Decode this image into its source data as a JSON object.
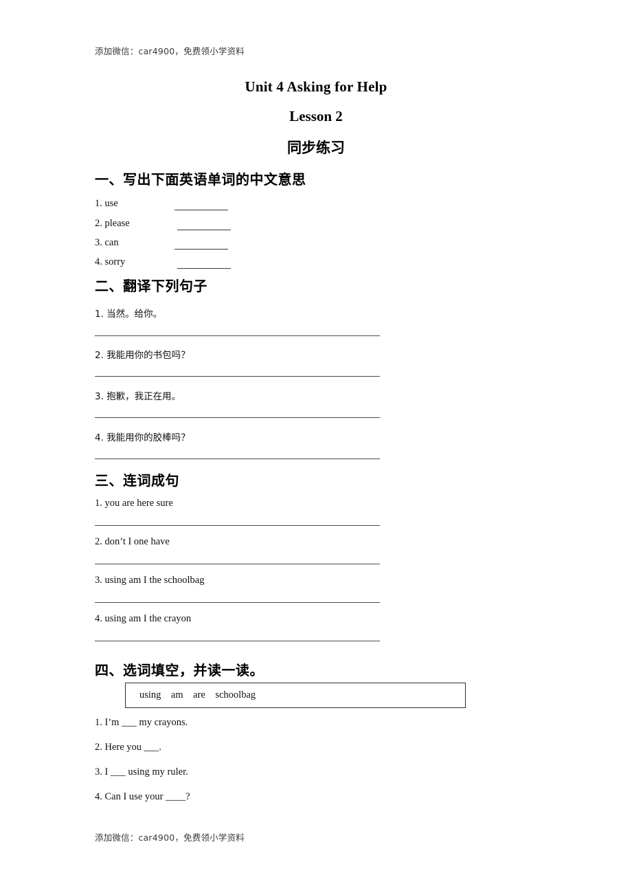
{
  "watermark": {
    "top": "添加微信：car4900，免费领小学资料",
    "bottom": "添加微信：car4900，免费领小学资料"
  },
  "titles": {
    "unit": "Unit 4 Asking for Help",
    "lesson": "Lesson 2",
    "chinese": "同步练习"
  },
  "sections": [
    {
      "heading": "一、写出下面英语单词的中文意思",
      "items": [
        {
          "label": "1. use"
        },
        {
          "label": "2. please"
        },
        {
          "label": "3. can"
        },
        {
          "label": "4. sorry"
        }
      ]
    },
    {
      "heading": "二、翻译下列句子",
      "items": [
        {
          "label": "1. 当然。给你。"
        },
        {
          "label": "2. 我能用你的书包吗？"
        },
        {
          "label": "3. 抱歉，我正在用。"
        },
        {
          "label": "4. 我能用你的胶棒吗？"
        }
      ]
    },
    {
      "heading": "三、连词成句",
      "items": [
        {
          "label": "1. you are here sure"
        },
        {
          "label": "2. don’t I one have"
        },
        {
          "label": "3. using am I the schoolbag"
        },
        {
          "label": "4. using am I the crayon"
        }
      ]
    },
    {
      "heading": "四、选词填空，并读一读。",
      "word_bank": "using    am    are    schoolbag",
      "items": [
        {
          "label": "1. I’m ___ my crayons."
        },
        {
          "label": "2. Here you ___."
        },
        {
          "label": "3. I ___ using my ruler."
        },
        {
          "label": "4. Can I use your ____?"
        }
      ]
    }
  ]
}
